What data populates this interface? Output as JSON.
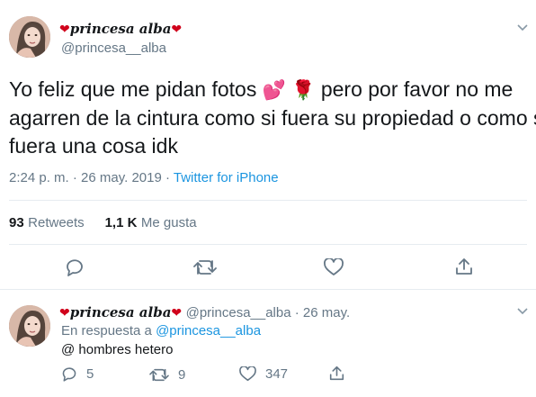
{
  "main_tweet": {
    "display_name": "princesa alba",
    "handle": "@princesa__alba",
    "text_part1": "Yo feliz que me pidan fotos",
    "emoji_hearts": "💕",
    "emoji_rose": "🌹",
    "text_part2": " pero por favor no me",
    "text_line2": "agarren de la cintura como si fuera su propiedad o como si",
    "text_line3": "fuera una cosa idk",
    "time": "2:24 p. m.",
    "separator": " · ",
    "date": "26 may. 2019",
    "source": "Twitter for iPhone",
    "retweets_count": "93",
    "retweets_label": "Retweets",
    "likes_count": "1,1 K",
    "likes_label": "Me gusta"
  },
  "reply_tweet": {
    "display_name": "princesa alba",
    "handle": "@princesa__alba",
    "separator": " · ",
    "date": "26 may.",
    "reply_prefix": "En respuesta a",
    "reply_to": "@princesa__alba",
    "text": "@ hombres hetero",
    "reply_count": "5",
    "retweet_count": "9",
    "like_count": "347"
  },
  "colors": {
    "link": "#1b95e0",
    "muted": "#657786",
    "heart": "#d0021b",
    "divider": "#e6ecf0"
  }
}
